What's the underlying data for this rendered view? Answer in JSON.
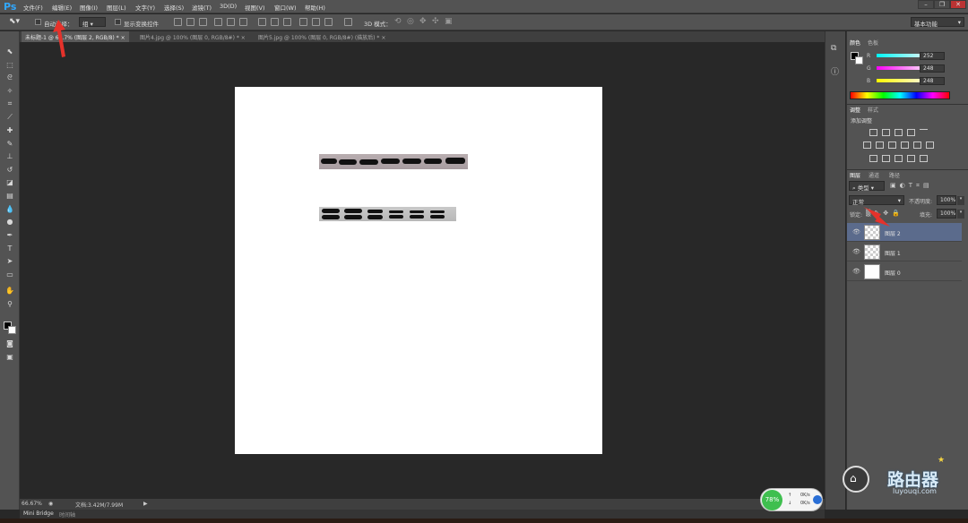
{
  "app": {
    "logo": "Ps"
  },
  "menu": [
    "文件(F)",
    "编辑(E)",
    "图像(I)",
    "图层(L)",
    "文字(Y)",
    "选择(S)",
    "滤镜(T)",
    "3D(D)",
    "视图(V)",
    "窗口(W)",
    "帮助(H)"
  ],
  "options_bar": {
    "auto_select_label": "自动选择：",
    "auto_select_value": "组",
    "show_transform_label": "显示变换控件",
    "mode_3d_label": "3D 模式：",
    "workspace": "基本功能"
  },
  "tabs": [
    {
      "label": "未标题-1 @ 66.7% (图层 2, RGB/8) *",
      "close": "×"
    },
    {
      "label": "图片4.jpg @ 100% (图层 0, RGB/8#) *",
      "close": "×"
    },
    {
      "label": "图片5.jpg @ 100% (图层 0, RGB/8#) (描放后) *",
      "close": "×"
    }
  ],
  "status": {
    "zoom": "66.67%",
    "doc_info": "文档:3.42M/7.99M"
  },
  "bottom_tabs": [
    "Mini Bridge",
    "时间轴"
  ],
  "color_panel": {
    "tabs": [
      "颜色",
      "色板"
    ],
    "r_label": "R",
    "g_label": "G",
    "b_label": "B",
    "r": "252",
    "g": "248",
    "b": "248"
  },
  "adjust_panel": {
    "tabs": [
      "调整",
      "样式"
    ],
    "title": "添加调整"
  },
  "layers_panel": {
    "tabs": [
      "图层",
      "通道",
      "路径"
    ],
    "filter_kind": "类型",
    "blend_mode": "正常",
    "opacity_label": "不透明度:",
    "opacity": "100%",
    "lock_label": "锁定:",
    "fill_label": "填充:",
    "fill": "100%",
    "layers": [
      {
        "name": "图层 2",
        "selected": true
      },
      {
        "name": "图层 1",
        "selected": false
      },
      {
        "name": "图层 0",
        "selected": false
      }
    ]
  },
  "network_widget": {
    "percent": "78%",
    "up": "0K/s",
    "down": "0K/s"
  },
  "watermark": {
    "title": "路由器",
    "site": "luyouqi.com"
  },
  "colors": {
    "accent": "#31a8ff",
    "selected_layer": "#5b6b8c",
    "arrow": "#e5322b"
  }
}
